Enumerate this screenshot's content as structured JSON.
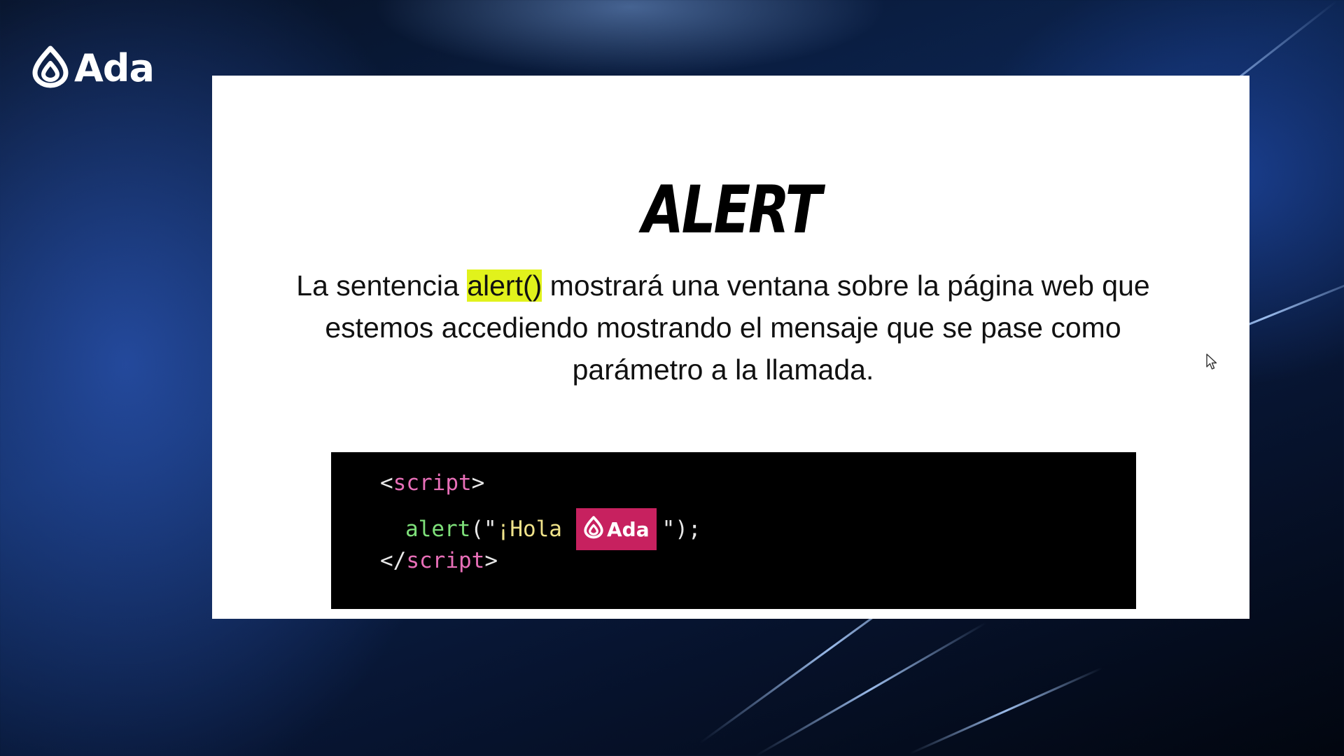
{
  "brand": {
    "logo_text": "Ada"
  },
  "slide": {
    "title": "ALERT",
    "description": {
      "before": "La sentencia ",
      "highlight": "alert()",
      "after": " mostrará una ventana sobre la página web que estemos accediendo mostrando el mensaje que se pase como parámetro a la llamada."
    },
    "code": {
      "open_lt": "<",
      "open_tag": "script",
      "open_gt": ">",
      "call_fn": "alert",
      "call_open": "(\"",
      "call_text": "¡Hola",
      "badge_text": "Ada",
      "call_close": "\");",
      "close_lt": "</",
      "close_tag": "script",
      "close_gt": ">"
    }
  },
  "colors": {
    "highlight": "#e1f21c",
    "badge": "#c7215f",
    "code_background": "#000000",
    "tag": "#e86fb8",
    "function": "#7ee07a",
    "string": "#f0e38a"
  },
  "icons": {
    "brand": "ada-logo-icon",
    "pointer": "mouse-pointer-icon"
  }
}
